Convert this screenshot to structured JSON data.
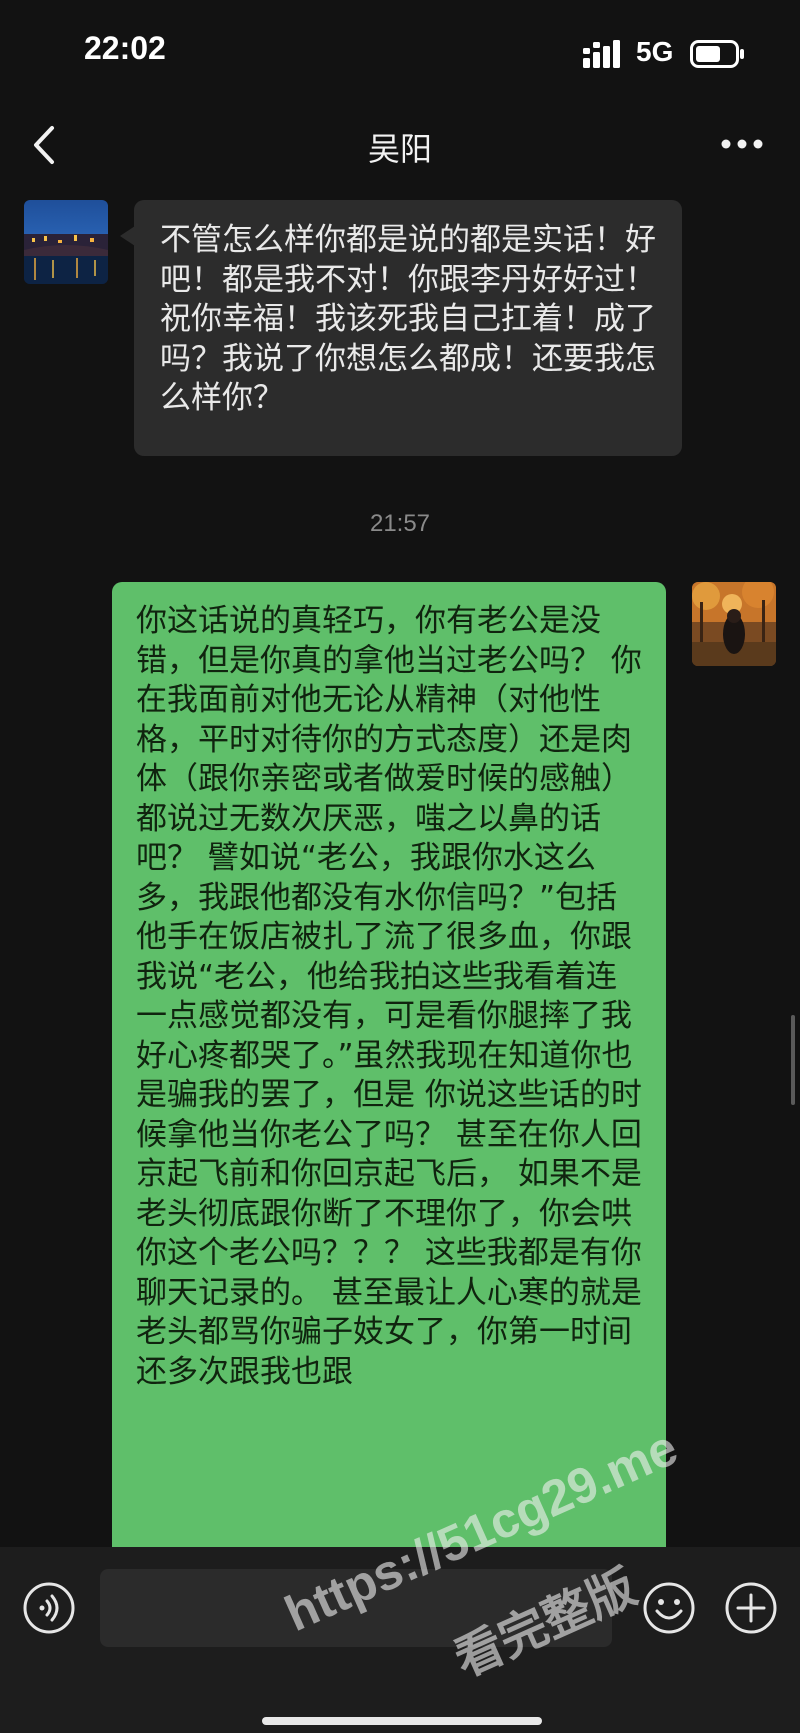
{
  "status_bar": {
    "time": "22:02",
    "network": "5G",
    "signal_icon": "signal-bars-icon",
    "battery_icon": "battery-icon"
  },
  "nav": {
    "back_icon": "chevron-left-icon",
    "title": "吴阳",
    "more_icon": "more-dots-icon"
  },
  "messages": [
    {
      "direction": "incoming",
      "avatar": "night-city-photo",
      "text": "不管怎么样你都是说的都是实话！好吧！都是我不对！你跟李丹好好过！祝你幸福！我该死我自己扛着！成了吗？我说了你想怎么都成！还要我怎么样你？"
    },
    {
      "type": "timestamp",
      "text": "21:57"
    },
    {
      "direction": "outgoing",
      "avatar": "autumn-forest-photo",
      "text": "你这话说的真轻巧，你有老公是没错，但是你真的拿他当过老公吗？ 你在我面前对他无论从精神（对他性格，平时对待你的方式态度）还是肉体（跟你亲密或者做爱时候的感触）都说过无数次厌恶，嗤之以鼻的话吧？ 譬如说“老公，我跟你水这么多，我跟他都没有水你信吗？”包括他手在饭店被扎了流了很多血，你跟我说“老公，他给我拍这些我看着连一点感觉都没有，可是看你腿摔了我好心疼都哭了。”虽然我现在知道你也是骗我的罢了，但是 你说这些话的时候拿他当你老公了吗？ 甚至在你人回京起飞前和你回京起飞后， 如果不是老头彻底跟你断了不理你了，你会哄你这个老公吗？？？ 这些我都是有你聊天记录的。 甚至最让人心寒的就是 老头都骂你骗子妓女了，你第一时间还多次跟我也跟"
    }
  ],
  "input_bar": {
    "voice_icon": "voice-icon",
    "input_value": "",
    "emoji_icon": "emoji-icon",
    "add_icon": "plus-circle-icon"
  },
  "watermark": {
    "line1": "https://51cg29.me",
    "line2": "看完整版"
  },
  "colors": {
    "background": "#121212",
    "incoming_bubble": "#2c2c2c",
    "outgoing_bubble": "#5fbf6a"
  }
}
